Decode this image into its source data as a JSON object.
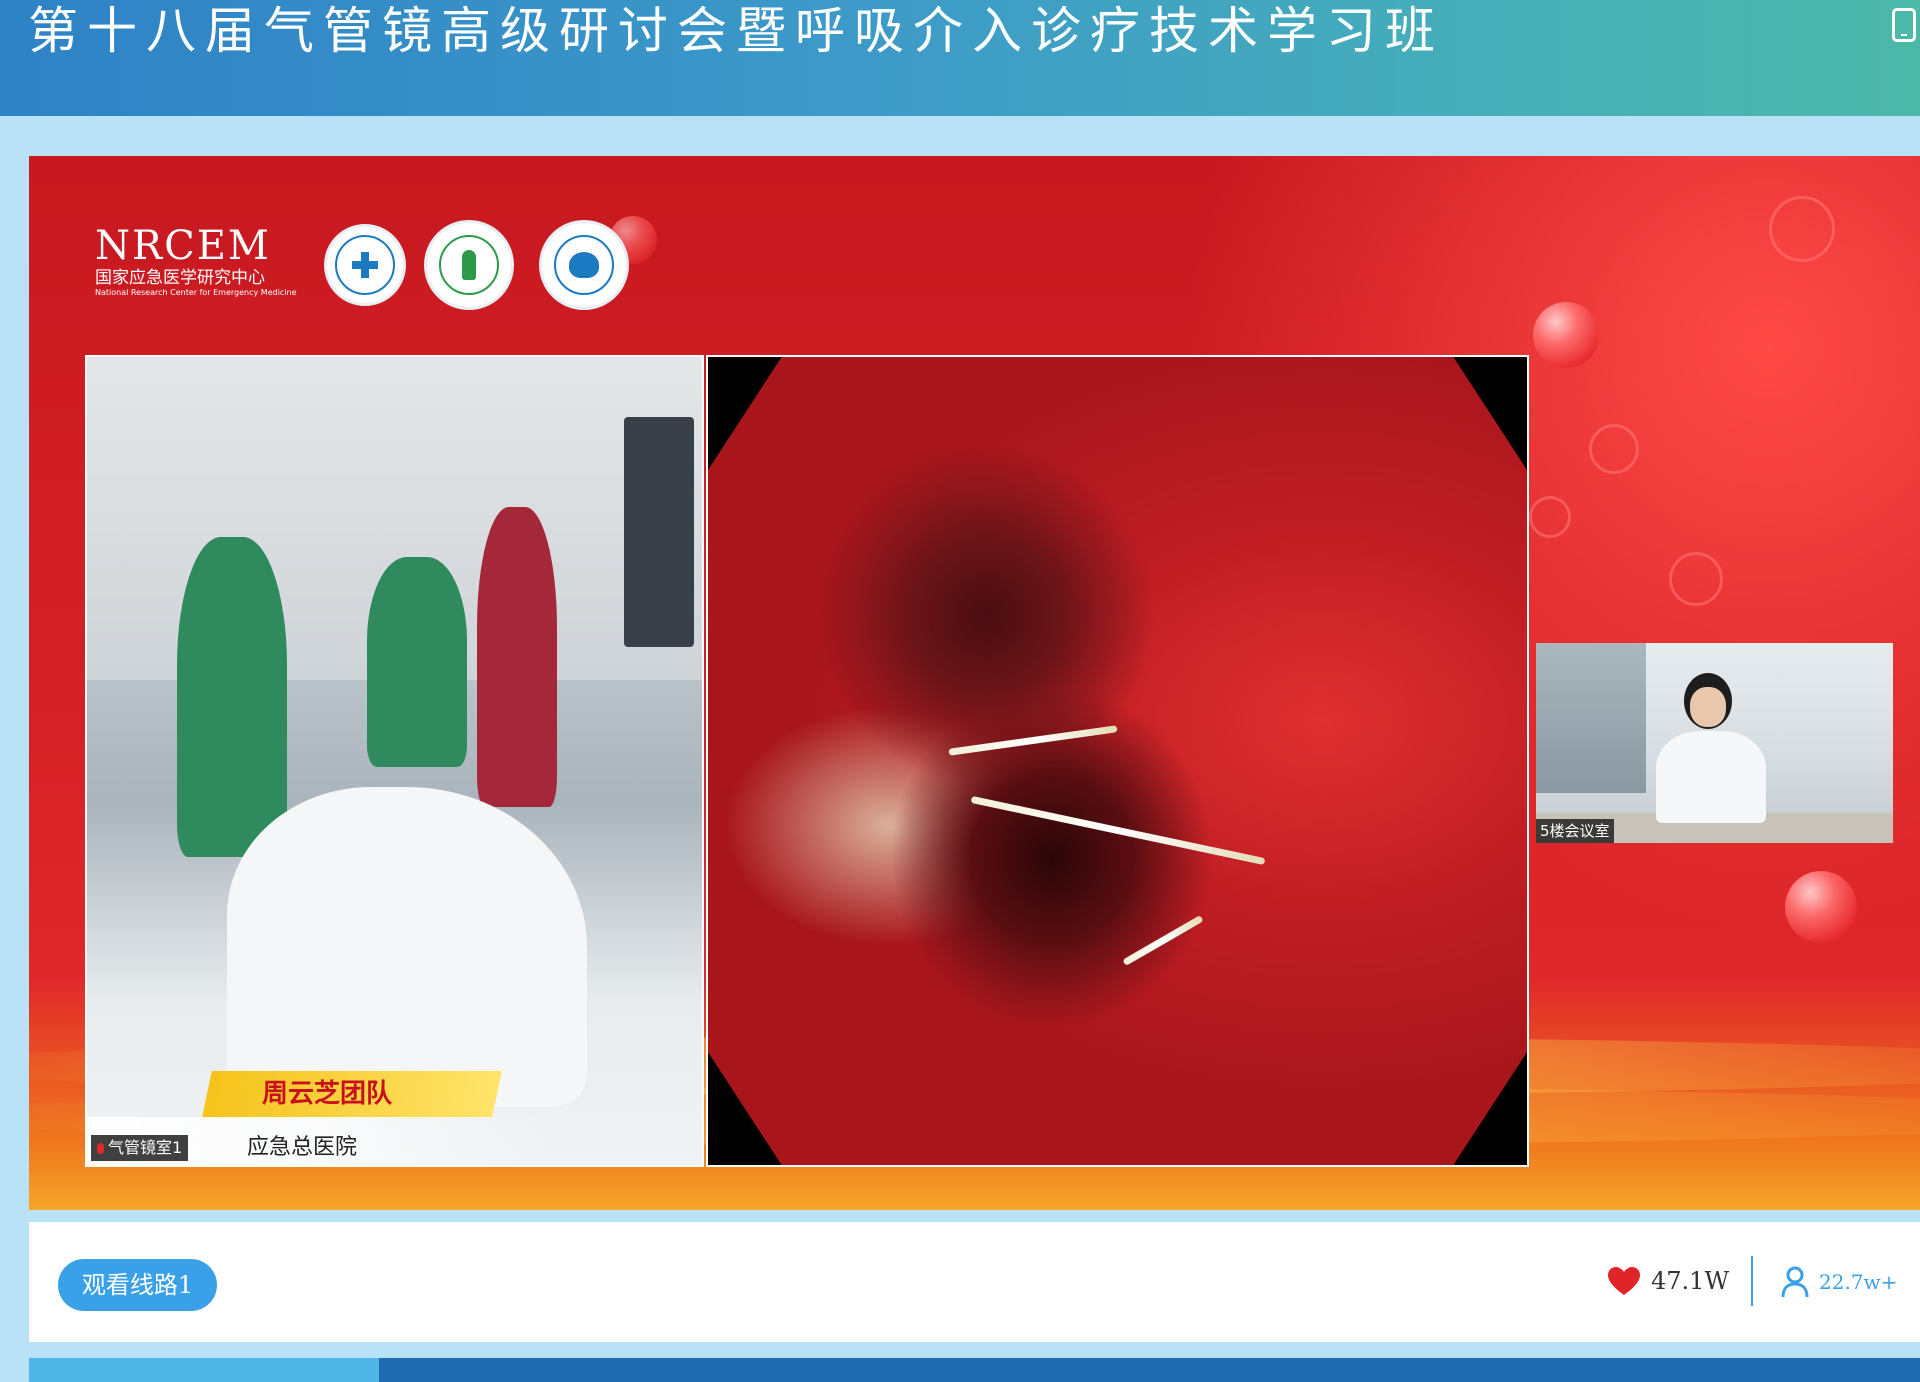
{
  "header": {
    "title": "第十八届气管镜高级研讨会暨呼吸介入诊疗技术学习班"
  },
  "player": {
    "logo": {
      "abbr": "NRCEM",
      "name_cn": "国家应急医学研究中心",
      "name_en": "National Research Center for Emergency Medicine"
    },
    "main_feed": {
      "team_caption": "周云芝团队",
      "hospital_caption": "应急总医院",
      "room_label": "气管镜室1"
    },
    "pip_feed": {
      "room_label": "5楼会议室"
    }
  },
  "bottom_bar": {
    "route_button": "观看线路1",
    "likes": "47.1W",
    "viewers": "22.7w+"
  },
  "progress": {
    "fraction": 0.185
  },
  "colors": {
    "accent": "#3aa0e8",
    "heart": "#e0242a",
    "banner_red": "#d62126",
    "caption_red": "#c8101a"
  },
  "icons": [
    "tablet-icon",
    "mic-muted-icon",
    "heart-icon",
    "user-icon"
  ]
}
